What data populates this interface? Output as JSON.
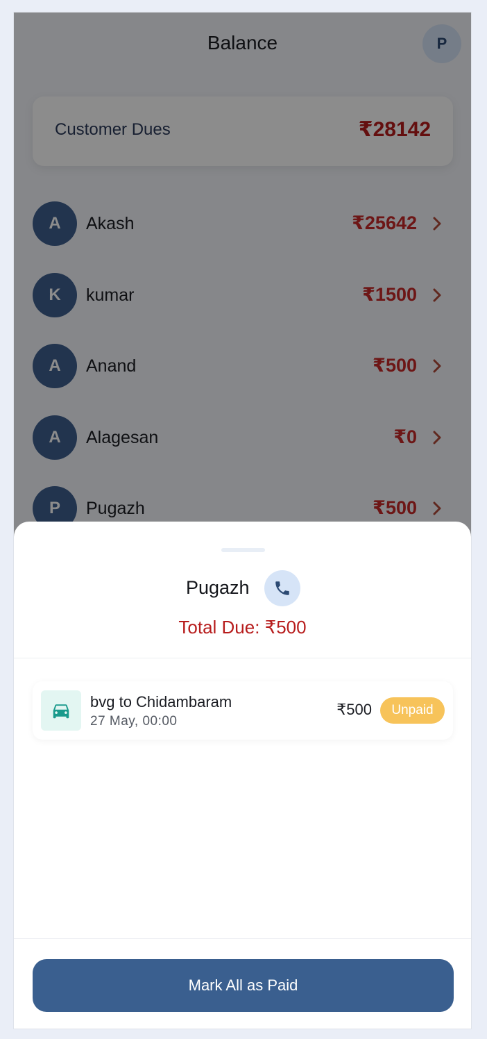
{
  "header": {
    "title": "Balance",
    "profile_initial": "P"
  },
  "dues_card": {
    "label": "Customer Dues",
    "amount": "₹28142"
  },
  "customers": [
    {
      "initial": "A",
      "name": "Akash",
      "amount": "₹25642"
    },
    {
      "initial": "K",
      "name": "kumar",
      "amount": "₹1500"
    },
    {
      "initial": "A",
      "name": "Anand",
      "amount": "₹500"
    },
    {
      "initial": "A",
      "name": "Alagesan",
      "amount": "₹0"
    },
    {
      "initial": "P",
      "name": "Pugazh",
      "amount": "₹500"
    }
  ],
  "sheet": {
    "name": "Pugazh",
    "total_due": "Total Due: ₹500",
    "trip": {
      "route": "bvg to Chidambaram",
      "date": "27 May, 00:00",
      "amount": "₹500",
      "status": "Unpaid"
    },
    "mark_all_label": "Mark All as Paid"
  },
  "colors": {
    "primary": "#3a5f8f",
    "due_red": "#b71c1c",
    "unpaid_badge": "#f7c35a",
    "trip_icon_bg": "#e3f6f2",
    "trip_icon": "#1a9a8c"
  },
  "icons": {
    "call": "phone-icon",
    "trip": "car-icon",
    "row_action": "chevron-right-icon"
  }
}
